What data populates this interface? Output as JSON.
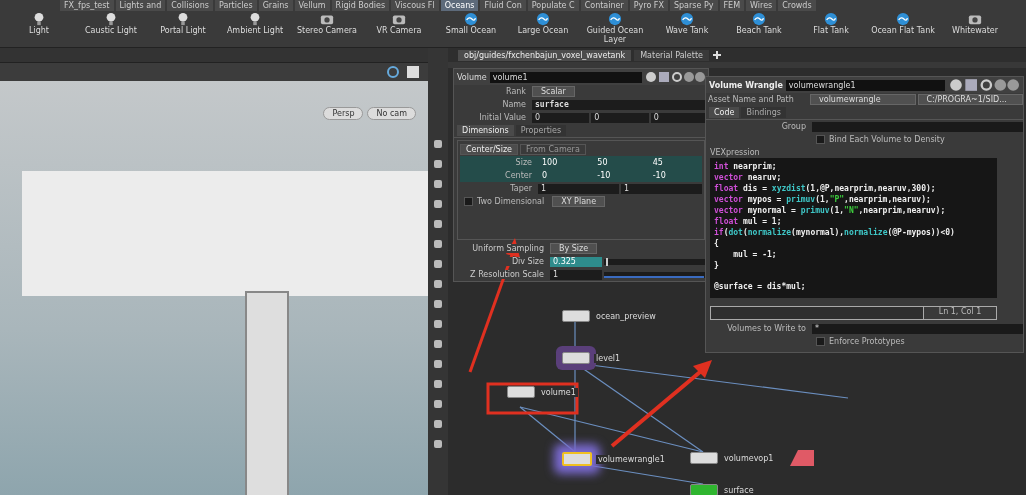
{
  "shelf": {
    "tabs": [
      {
        "label": "FX_fps_test",
        "selected": false
      },
      {
        "label": "Lights and",
        "selected": false
      },
      {
        "label": "Collisions",
        "selected": false
      },
      {
        "label": "Particles",
        "selected": false
      },
      {
        "label": "Grains",
        "selected": false
      },
      {
        "label": "Vellum",
        "selected": false
      },
      {
        "label": "Rigid Bodies",
        "selected": false
      },
      {
        "label": "Viscous Fl",
        "selected": false
      },
      {
        "label": "Oceans",
        "selected": true
      },
      {
        "label": "Fluid Con",
        "selected": false
      },
      {
        "label": "Populate C",
        "selected": false
      },
      {
        "label": "Container",
        "selected": false
      },
      {
        "label": "Pyro FX",
        "selected": false
      },
      {
        "label": "Sparse Py",
        "selected": false
      },
      {
        "label": "FEM",
        "selected": false
      },
      {
        "label": "Wires",
        "selected": false
      },
      {
        "label": "Crowds",
        "selected": false
      }
    ],
    "tools": [
      {
        "label": "Light",
        "kind": "light"
      },
      {
        "label": "Caustic Light",
        "kind": "light"
      },
      {
        "label": "Portal Light",
        "kind": "light"
      },
      {
        "label": "Ambient Light",
        "kind": "light"
      },
      {
        "label": "Stereo Camera",
        "kind": "camera"
      },
      {
        "label": "VR Camera",
        "kind": "camera"
      },
      {
        "label": "Small Ocean",
        "kind": "ocean"
      },
      {
        "label": "Large Ocean",
        "kind": "ocean"
      },
      {
        "label": "Guided Ocean Layer",
        "kind": "ocean"
      },
      {
        "label": "Wave Tank",
        "kind": "ocean"
      },
      {
        "label": "Beach Tank",
        "kind": "ocean"
      },
      {
        "label": "Flat Tank",
        "kind": "ocean"
      },
      {
        "label": "Ocean Flat Tank",
        "kind": "ocean"
      },
      {
        "label": "Whitewater",
        "kind": "camera"
      }
    ]
  },
  "viewport": {
    "view": "Persp",
    "camera": "No cam"
  },
  "network": {
    "tabs": [
      {
        "label": "obj/guides/fxchenbajun_voxel_wavetank",
        "selected": true
      },
      {
        "label": "Material Palette",
        "selected": false
      }
    ],
    "nodes": [
      {
        "name": "ocean_preview",
        "kind": "plain",
        "selected": false
      },
      {
        "name": "level1",
        "kind": "ring",
        "selected": false
      },
      {
        "name": "volume1",
        "kind": "plain",
        "selected": false
      },
      {
        "name": "volumewrangle1",
        "kind": "glow",
        "selected": true
      },
      {
        "name": "volumevop1",
        "kind": "plain",
        "selected": false
      },
      {
        "name": "surface",
        "kind": "green",
        "selected": false
      }
    ]
  },
  "volume_panel": {
    "type": "Volume",
    "name": "volume1",
    "rank_label": "Rank",
    "rank": "Scalar",
    "name_label": "Name",
    "name_value": "surface",
    "initial_label": "Initial Value",
    "initial": [
      "0",
      "0",
      "0"
    ],
    "tabs": [
      {
        "label": "Dimensions",
        "selected": true
      },
      {
        "label": "Properties",
        "selected": false
      }
    ],
    "modes": [
      {
        "label": "Center/Size",
        "selected": true
      },
      {
        "label": "From Camera",
        "selected": false
      }
    ],
    "size_label": "Size",
    "size": [
      "100",
      "50",
      "45"
    ],
    "center_label": "Center",
    "center": [
      "0",
      "-10",
      "-10"
    ],
    "taper_label": "Taper",
    "taper": [
      "1",
      "1"
    ],
    "two_dimensional": {
      "label": "Two Dimensional",
      "checked": false,
      "plane": "XY Plane"
    },
    "sampling_label": "Uniform Sampling",
    "sampling": "By Size",
    "div_label": "Div Size",
    "div": "0.325",
    "div_slider": {
      "level": 0.02
    },
    "zres_label": "Z Resolution Scale",
    "zres": "1",
    "zres_slider": {
      "level": 0.98
    }
  },
  "wrangle_panel": {
    "type": "Volume Wrangle",
    "name": "volumewrangle1",
    "asset_label": "Asset Name and Path",
    "asset": "volumewrangle",
    "path": "C:/PROGRA~1/SID...",
    "tabs": [
      {
        "label": "Code",
        "selected": true
      },
      {
        "label": "Bindings",
        "selected": false
      }
    ],
    "group_label": "Group",
    "bind": {
      "label": "Bind Each Volume to Density",
      "checked": false
    },
    "vex_label": "VEXpression",
    "code": [
      [
        {
          "kind": "keyword",
          "t": "int"
        },
        {
          "kind": "plain",
          "t": " nearprim;"
        }
      ],
      [
        {
          "kind": "keyword",
          "t": "vector"
        },
        {
          "kind": "plain",
          "t": " nearuv;"
        }
      ],
      [
        {
          "kind": "keyword",
          "t": "float"
        },
        {
          "kind": "plain",
          "t": " dis = "
        },
        {
          "kind": "function",
          "t": "xyzdist"
        },
        {
          "kind": "plain",
          "t": "(1,@P,nearprim,nearuv,300);"
        }
      ],
      [
        {
          "kind": "keyword",
          "t": "vector"
        },
        {
          "kind": "plain",
          "t": " mypos = "
        },
        {
          "kind": "function",
          "t": "primuv"
        },
        {
          "kind": "plain",
          "t": "(1,"
        },
        {
          "kind": "string",
          "t": "\"P\""
        },
        {
          "kind": "plain",
          "t": ",nearprim,nearuv);"
        }
      ],
      [
        {
          "kind": "keyword",
          "t": "vector"
        },
        {
          "kind": "plain",
          "t": " mynormal = "
        },
        {
          "kind": "function",
          "t": "primuv"
        },
        {
          "kind": "plain",
          "t": "(1,"
        },
        {
          "kind": "string",
          "t": "\"N\""
        },
        {
          "kind": "plain",
          "t": ",nearprim,nearuv);"
        }
      ],
      [
        {
          "kind": "keyword",
          "t": "float"
        },
        {
          "kind": "plain",
          "t": " mul = 1;"
        }
      ],
      [
        {
          "kind": "keyword",
          "t": "if"
        },
        {
          "kind": "plain",
          "t": "("
        },
        {
          "kind": "function",
          "t": "dot"
        },
        {
          "kind": "plain",
          "t": "("
        },
        {
          "kind": "function",
          "t": "normalize"
        },
        {
          "kind": "plain",
          "t": "(mynormal),"
        },
        {
          "kind": "function",
          "t": "normalize"
        },
        {
          "kind": "plain",
          "t": "(@P-mypos))<0)"
        }
      ],
      [
        {
          "kind": "plain",
          "t": "{"
        }
      ],
      [
        {
          "kind": "plain",
          "t": "    mul = -1;"
        }
      ],
      [
        {
          "kind": "plain",
          "t": "}"
        }
      ],
      [
        {
          "kind": "plain",
          "t": "@surface = dis*mul;"
        }
      ]
    ],
    "cursor": "Ln 1, Col 1",
    "write_label": "Volumes to Write to",
    "write": "*",
    "enforce": {
      "label": "Enforce Prototypes",
      "checked": false
    }
  }
}
